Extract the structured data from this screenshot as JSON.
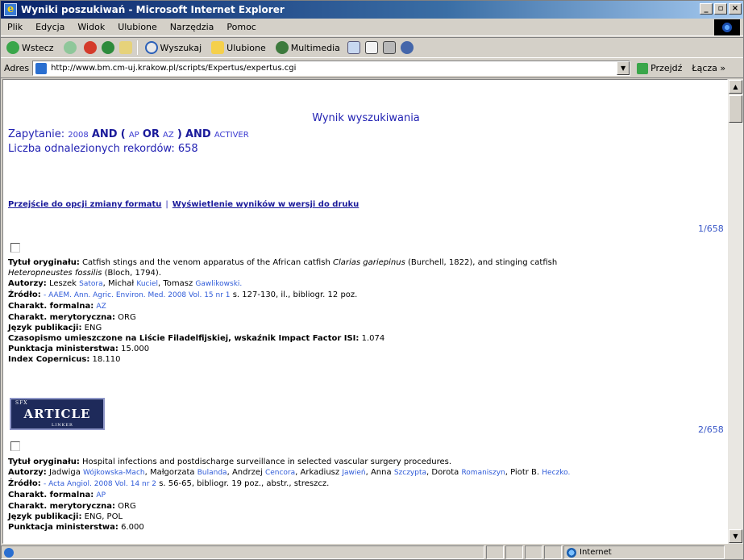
{
  "window": {
    "title": "Wyniki poszukiwań - Microsoft Internet Explorer",
    "btn_min": "_",
    "btn_max": "▫",
    "btn_close": "×"
  },
  "menu": {
    "items": [
      "Plik",
      "Edycja",
      "Widok",
      "Ulubione",
      "Narzędzia",
      "Pomoc"
    ]
  },
  "toolbar": {
    "back": "Wstecz",
    "search": "Wyszukaj",
    "favorites": "Ulubione",
    "multimedia": "Multimedia"
  },
  "address": {
    "label": "Adres",
    "url": "http://www.bm.cm-uj.krakow.pl/scripts/Expertus/expertus.cgi",
    "go": "Przejdź",
    "links": "Łącza »"
  },
  "page": {
    "heading": "Wynik wyszukiwania",
    "query_label": "Zapytanie:",
    "query_parts": [
      "2008",
      "AND",
      "(",
      "AP",
      "OR",
      "AZ",
      ")",
      "AND",
      "ACTIVER"
    ],
    "count_label": "Liczba odnalezionych rekordów: 658",
    "link_format": "Przejście do opcji zmiany formatu",
    "link_separator": "|",
    "link_print": "Wyświetlenie wyników w wersji do druku"
  },
  "records": [
    {
      "number": "1/658",
      "title_label": "Tytuł oryginału:",
      "title_text_a": " Catfish stings and the venom apparatus of the African catfish ",
      "title_italic_a": "Clarias gariepinus",
      "title_text_b": " (Burchell, 1822), and stinging catfish",
      "title_italic_b": "Heteropneustes fossilis",
      "title_text_c": " (Bloch, 1794).",
      "authors_label": "Autorzy:",
      "authors": [
        {
          "first": "Leszek",
          "last": "Satora"
        },
        {
          "first": "Michał",
          "last": "Kuciel"
        },
        {
          "first": "Tomasz",
          "last": "Gawlikowski."
        }
      ],
      "source_label": "Źródło:",
      "source_link": "- AAEM. Ann. Agric. Environ. Med. 2008 Vol. 15 nr 1",
      "source_rest": " s. 127-130, il., bibliogr. 12 poz.",
      "formal_label": "Charakt. formalna:",
      "formal_value": "AZ",
      "subject_label": "Charakt. merytoryczna:",
      "subject_value": "ORG",
      "lang_label": "Język publikacji:",
      "lang_value": "ENG",
      "journal_label": "Czasopismo umieszczone na Liście Filadelfijskiej, wskaźnik Impact Factor ISI:",
      "journal_value": "1.074",
      "ministry_label": "Punktacja ministerstwa:",
      "ministry_value": "15.000",
      "copernicus_label": "Index Copernicus:",
      "copernicus_value": "18.110"
    },
    {
      "number": "2/658",
      "title_label": "Tytuł oryginału:",
      "title_text": " Hospital infections and postdischarge surveillance in selected vascular surgery procedures.",
      "authors_label": "Autorzy:",
      "authors": [
        {
          "first": "Jadwiga",
          "last": "Wójkowska-Mach"
        },
        {
          "first": "Małgorzata",
          "last": "Bulanda"
        },
        {
          "first": "Andrzej",
          "last": "Cencora"
        },
        {
          "first": "Arkadiusz",
          "last": "Jawień"
        },
        {
          "first": "Anna",
          "last": "Szczypta"
        },
        {
          "first": "Dorota",
          "last": "Romaniszyn"
        },
        {
          "first": "Piotr B.",
          "last": "Heczko."
        }
      ],
      "source_label": "Źródło:",
      "source_link": "- Acta Angiol. 2008 Vol. 14 nr 2",
      "source_rest": " s. 56-65, bibliogr. 19 poz., abstr., streszcz.",
      "formal_label": "Charakt. formalna:",
      "formal_value": "AP",
      "subject_label": "Charakt. merytoryczna:",
      "subject_value": "ORG",
      "lang_label": "Język publikacji:",
      "lang_value": "ENG, POL",
      "ministry_label": "Punktacja ministerstwa:",
      "ministry_value": "6.000"
    }
  ],
  "badge": {
    "small_top": "SFX",
    "main": "ARTICLE",
    "small_bottom": "LINKER"
  },
  "status": {
    "zone": "Internet"
  }
}
